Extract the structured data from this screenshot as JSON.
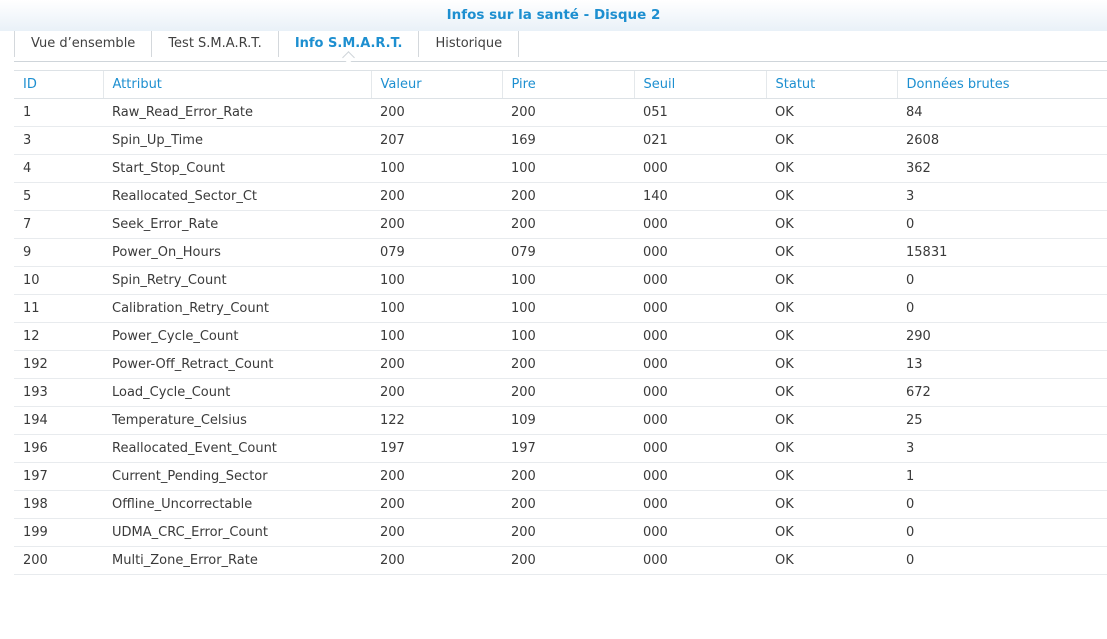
{
  "window": {
    "title": "Infos sur la santé - Disque 2"
  },
  "tabs": [
    {
      "label": "Vue d’ensemble",
      "active": false
    },
    {
      "label": "Test S.M.A.R.T.",
      "active": false
    },
    {
      "label": "Info S.M.A.R.T.",
      "active": true
    },
    {
      "label": "Historique",
      "active": false
    }
  ],
  "table": {
    "columns": [
      "ID",
      "Attribut",
      "Valeur",
      "Pire",
      "Seuil",
      "Statut",
      "Données brutes"
    ],
    "rows": [
      [
        "1",
        "Raw_Read_Error_Rate",
        "200",
        "200",
        "051",
        "OK",
        "84"
      ],
      [
        "3",
        "Spin_Up_Time",
        "207",
        "169",
        "021",
        "OK",
        "2608"
      ],
      [
        "4",
        "Start_Stop_Count",
        "100",
        "100",
        "000",
        "OK",
        "362"
      ],
      [
        "5",
        "Reallocated_Sector_Ct",
        "200",
        "200",
        "140",
        "OK",
        "3"
      ],
      [
        "7",
        "Seek_Error_Rate",
        "200",
        "200",
        "000",
        "OK",
        "0"
      ],
      [
        "9",
        "Power_On_Hours",
        "079",
        "079",
        "000",
        "OK",
        "15831"
      ],
      [
        "10",
        "Spin_Retry_Count",
        "100",
        "100",
        "000",
        "OK",
        "0"
      ],
      [
        "11",
        "Calibration_Retry_Count",
        "100",
        "100",
        "000",
        "OK",
        "0"
      ],
      [
        "12",
        "Power_Cycle_Count",
        "100",
        "100",
        "000",
        "OK",
        "290"
      ],
      [
        "192",
        "Power-Off_Retract_Count",
        "200",
        "200",
        "000",
        "OK",
        "13"
      ],
      [
        "193",
        "Load_Cycle_Count",
        "200",
        "200",
        "000",
        "OK",
        "672"
      ],
      [
        "194",
        "Temperature_Celsius",
        "122",
        "109",
        "000",
        "OK",
        "25"
      ],
      [
        "196",
        "Reallocated_Event_Count",
        "197",
        "197",
        "000",
        "OK",
        "3"
      ],
      [
        "197",
        "Current_Pending_Sector",
        "200",
        "200",
        "000",
        "OK",
        "1"
      ],
      [
        "198",
        "Offline_Uncorrectable",
        "200",
        "200",
        "000",
        "OK",
        "0"
      ],
      [
        "199",
        "UDMA_CRC_Error_Count",
        "200",
        "200",
        "000",
        "OK",
        "0"
      ],
      [
        "200",
        "Multi_Zone_Error_Rate",
        "200",
        "200",
        "000",
        "OK",
        "0"
      ]
    ]
  },
  "colors": {
    "accent": "#1d8fd0",
    "text": "#3a3a3a"
  }
}
